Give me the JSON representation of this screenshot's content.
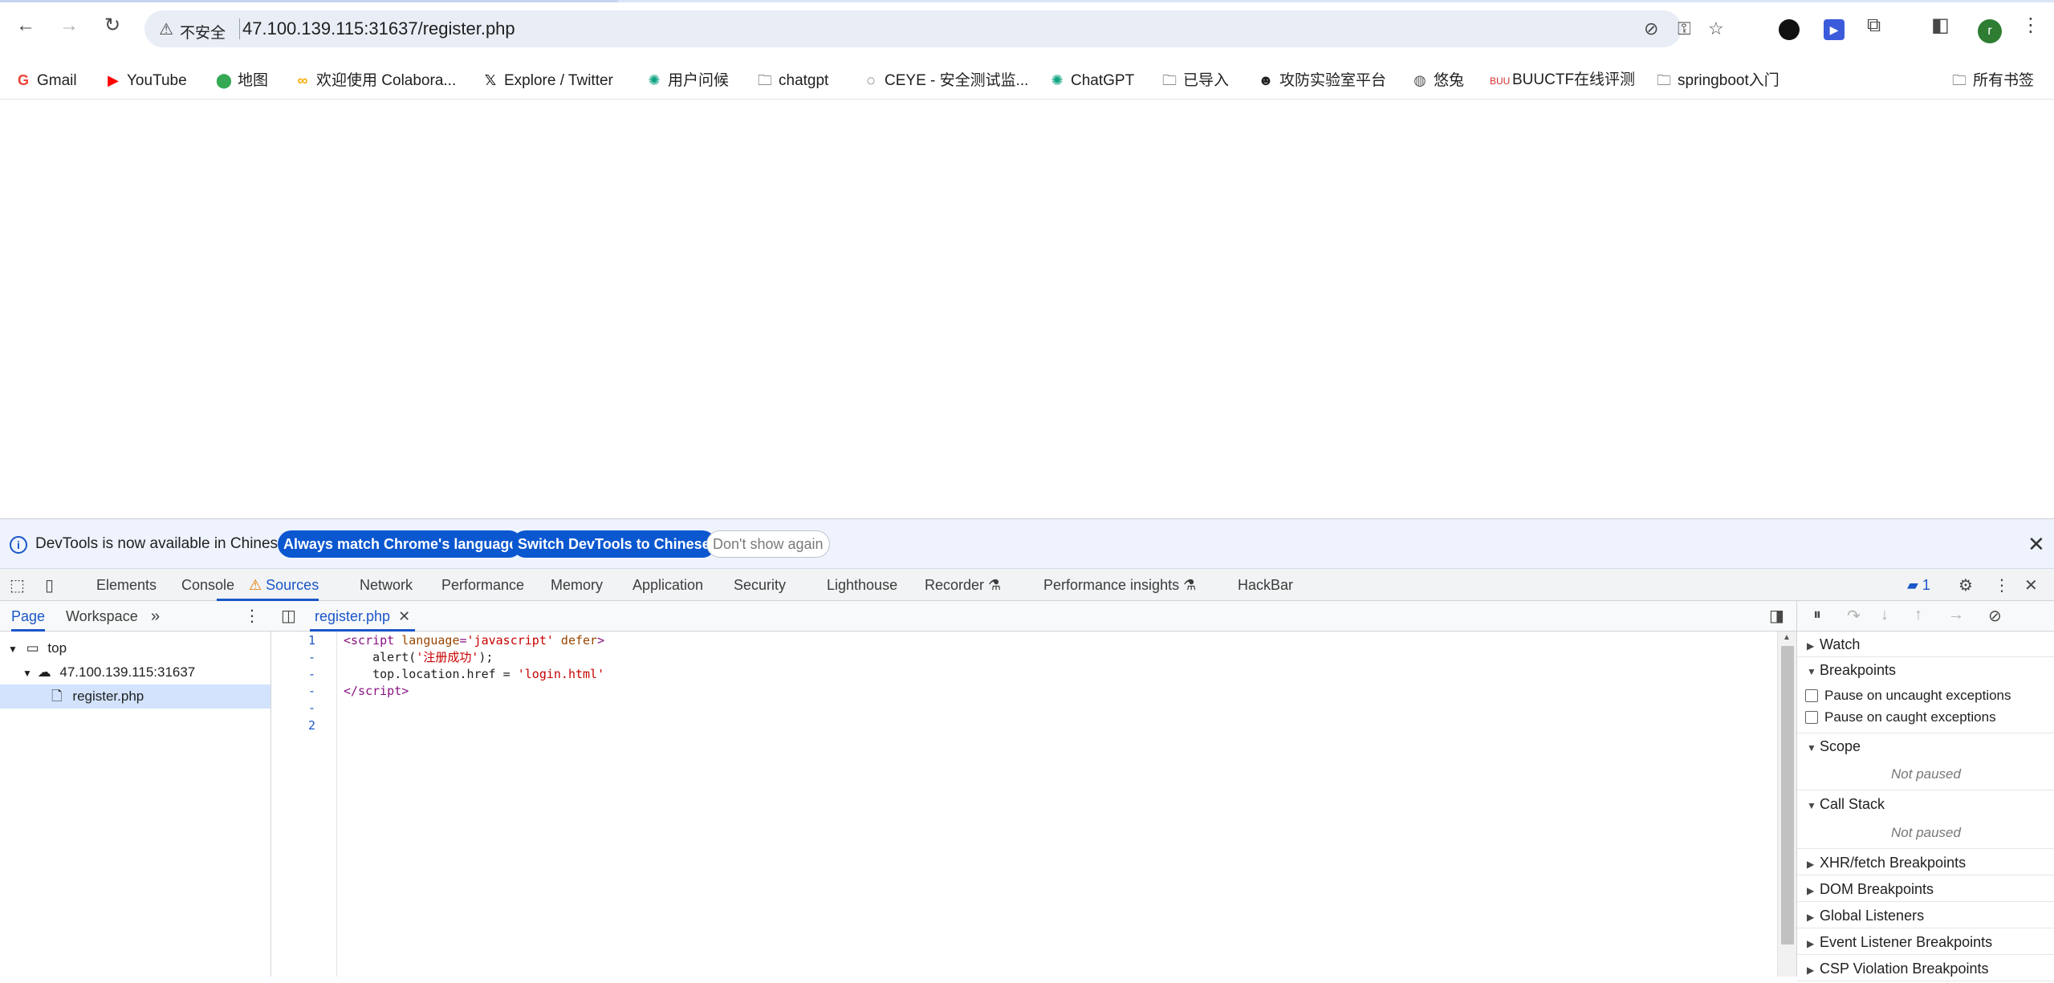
{
  "browser": {
    "address": {
      "security_label": "不安全",
      "url": "47.100.139.115:31637/register.php"
    },
    "avatar_letter": "r"
  },
  "bookmarks": [
    {
      "label": "Gmail",
      "icon": "gmail-icon"
    },
    {
      "label": "YouTube",
      "icon": "youtube-icon"
    },
    {
      "label": "地图",
      "icon": "maps-icon"
    },
    {
      "label": "欢迎使用 Colabora...",
      "icon": "colab-icon"
    },
    {
      "label": "Explore / Twitter",
      "icon": "x-icon"
    },
    {
      "label": "用户问候",
      "icon": "chatgpt-icon"
    },
    {
      "label": "chatgpt",
      "icon": "folder-icon"
    },
    {
      "label": "CEYE - 安全测试监...",
      "icon": "ceye-icon"
    },
    {
      "label": "ChatGPT",
      "icon": "chatgpt-icon"
    },
    {
      "label": "已导入",
      "icon": "folder-icon"
    },
    {
      "label": "攻防实验室平台",
      "icon": "spy-icon"
    },
    {
      "label": "悠兔",
      "icon": "globe-icon"
    },
    {
      "label": "BUUCTF在线评测",
      "icon": "buu-icon"
    },
    {
      "label": "springboot入门",
      "icon": "folder-icon"
    },
    {
      "label": "所有书签",
      "icon": "folder-icon"
    }
  ],
  "devtools": {
    "infobar": {
      "message": "DevTools is now available in Chinese!",
      "btn_match": "Always match Chrome's language",
      "btn_switch": "Switch DevTools to Chinese",
      "btn_dismiss": "Don't show again"
    },
    "tabs": [
      "Elements",
      "Console",
      "Sources",
      "Network",
      "Performance",
      "Memory",
      "Application",
      "Security",
      "Lighthouse",
      "Recorder",
      "Performance insights",
      "HackBar"
    ],
    "issues_count": "1",
    "navigator": {
      "tabs": [
        "Page",
        "Workspace"
      ],
      "tree": [
        "top",
        "47.100.139.115:31637",
        "register.php"
      ]
    },
    "editor": {
      "file_tab": "register.php",
      "line_numbers": [
        "1",
        "-",
        "-",
        "-",
        "-",
        "2"
      ]
    },
    "debugger": {
      "watch": "Watch",
      "breakpoints": "Breakpoints",
      "pause_uncaught": "Pause on uncaught exceptions",
      "pause_caught": "Pause on caught exceptions",
      "scope": "Scope",
      "not_paused": "Not paused",
      "call_stack": "Call Stack",
      "xhr": "XHR/fetch Breakpoints",
      "dom": "DOM Breakpoints",
      "global": "Global Listeners",
      "event": "Event Listener Breakpoints",
      "csp": "CSP Violation Breakpoints"
    }
  }
}
